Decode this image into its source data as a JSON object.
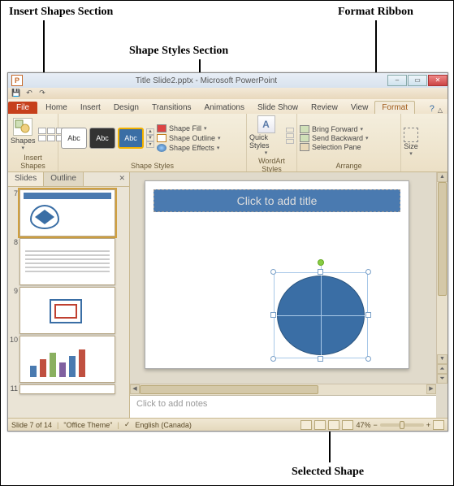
{
  "annotations": {
    "insert_shapes": "Insert Shapes Section",
    "shape_styles": "Shape Styles Section",
    "format_ribbon": "Format Ribbon",
    "selected_shape": "Selected Shape"
  },
  "titlebar": {
    "title": "Title Slide2.pptx - Microsoft PowerPoint"
  },
  "tabs": {
    "file": "File",
    "items": [
      "Home",
      "Insert",
      "Design",
      "Transitions",
      "Animations",
      "Slide Show",
      "Review",
      "View",
      "Format"
    ],
    "active": "Format"
  },
  "ribbon": {
    "insert_shapes": {
      "label": "Insert Shapes",
      "shapes_btn": "Shapes"
    },
    "shape_styles": {
      "label": "Shape Styles",
      "swatch_text": "Abc",
      "fill": "Shape Fill",
      "outline": "Shape Outline",
      "effects": "Shape Effects"
    },
    "wordart": {
      "label": "WordArt Styles",
      "quick": "Quick Styles"
    },
    "arrange": {
      "label": "Arrange",
      "bring_forward": "Bring Forward",
      "send_backward": "Send Backward",
      "selection_pane": "Selection Pane"
    },
    "size": {
      "label": "",
      "btn": "Size"
    }
  },
  "left_panel": {
    "tab_slides": "Slides",
    "tab_outline": "Outline",
    "thumbs": [
      7,
      8,
      9,
      10,
      11
    ],
    "selected": 7
  },
  "slide": {
    "title_placeholder": "Click to add title"
  },
  "notes": {
    "placeholder": "Click to add notes"
  },
  "statusbar": {
    "slide_info": "Slide 7 of 14",
    "theme": "\"Office Theme\"",
    "language": "English (Canada)",
    "zoom": "47%"
  }
}
